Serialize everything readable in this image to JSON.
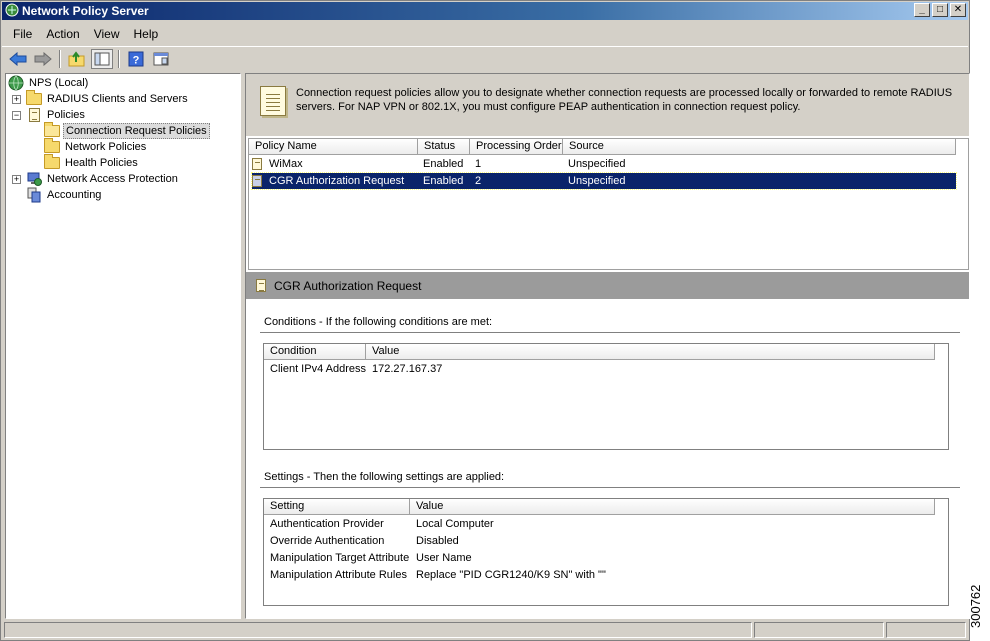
{
  "window": {
    "title": "Network Policy Server",
    "minimize": "_",
    "maximize": "□",
    "close": "✕"
  },
  "menu": [
    "File",
    "Action",
    "View",
    "Help"
  ],
  "toolbar_icons": [
    "back-icon",
    "forward-icon",
    "up-folder-icon",
    "show-hide-tree-icon",
    "help-icon",
    "properties-icon"
  ],
  "tree": {
    "root": "NPS (Local)",
    "items": [
      {
        "label": "RADIUS Clients and Servers",
        "expander": "+"
      },
      {
        "label": "Policies",
        "expander": "−"
      },
      {
        "label": "Connection Request Policies"
      },
      {
        "label": "Network Policies"
      },
      {
        "label": "Health Policies"
      },
      {
        "label": "Network Access Protection",
        "expander": "+"
      },
      {
        "label": "Accounting"
      }
    ]
  },
  "info": {
    "text": "Connection request policies allow you to designate whether connection requests are processed locally or forwarded to remote RADIUS servers. For NAP VPN or 802.1X, you must configure PEAP authentication in connection request policy."
  },
  "policy_list": {
    "columns": [
      "Policy Name",
      "Status",
      "Processing Order",
      "Source"
    ],
    "rows": [
      {
        "name": "WiMax",
        "status": "Enabled",
        "order": "1",
        "source": "Unspecified"
      },
      {
        "name": "CGR Authorization Request",
        "status": "Enabled",
        "order": "2",
        "source": "Unspecified"
      }
    ]
  },
  "details": {
    "title": "CGR Authorization Request",
    "conditions": {
      "heading": "Conditions - If the following conditions are met:",
      "columns": [
        "Condition",
        "Value"
      ],
      "rows": [
        {
          "condition": "Client IPv4 Address",
          "value": "172.27.167.37"
        }
      ]
    },
    "settings": {
      "heading": "Settings - Then the following settings are applied:",
      "columns": [
        "Setting",
        "Value"
      ],
      "rows": [
        {
          "setting": "Authentication Provider",
          "value": "Local Computer"
        },
        {
          "setting": "Override Authentication",
          "value": "Disabled"
        },
        {
          "setting": "Manipulation Target Attribute",
          "value": "User Name"
        },
        {
          "setting": "Manipulation Attribute Rules",
          "value": "Replace \"PID CGR1240/K9 SN\" with \"\""
        }
      ]
    }
  },
  "figure_id": "300762",
  "colors": {
    "title_gradient_start": "#0a246a",
    "selection": "#0a246a",
    "chrome": "#d4d0c8",
    "details_header": "#9b9b9b"
  }
}
